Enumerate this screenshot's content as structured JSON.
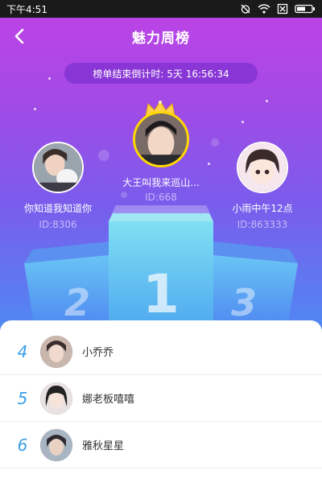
{
  "status_bar": {
    "time": "下午4:51"
  },
  "header": {
    "title": "魅力周榜"
  },
  "countdown": {
    "label": "榜单结束倒计时: 5天 16:56:34"
  },
  "top3": [
    {
      "rank": 1,
      "name": "大王叫我来巡山...",
      "id": "ID:668"
    },
    {
      "rank": 2,
      "name": "你知道我知道你",
      "id": "ID:8306"
    },
    {
      "rank": 3,
      "name": "小雨中午12点",
      "id": "ID:863333"
    }
  ],
  "podium_labels": [
    "1",
    "2",
    "3"
  ],
  "ranking": [
    {
      "rank": "4",
      "name": "小乔乔"
    },
    {
      "rank": "5",
      "name": "娜老板嘻嘻"
    },
    {
      "rank": "6",
      "name": "雅秋星星"
    }
  ],
  "colors": {
    "accent": "#3aa0e8",
    "gold": "#ffd700"
  }
}
